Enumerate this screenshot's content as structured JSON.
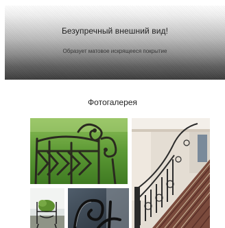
{
  "hero": {
    "title": "Безупречный внешний вид!",
    "subtitle": "Образует матовое искрящееся покрытие"
  },
  "gallery": {
    "title": "Фотогалерея",
    "photos": [
      {
        "subject": "wrought-iron garden bench on grass"
      },
      {
        "subject": "wrought-iron staircase railing with carpeted stairs"
      },
      {
        "subject": "small wrought-iron garden chair with plant"
      },
      {
        "subject": "dark wrought-iron scrollwork detail"
      }
    ]
  }
}
